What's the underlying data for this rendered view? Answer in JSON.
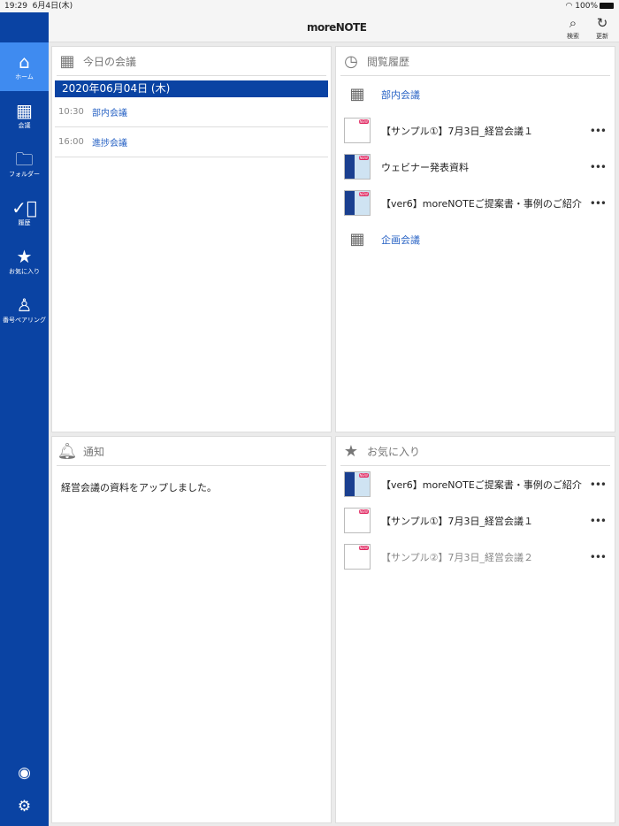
{
  "status": {
    "time": "19:29",
    "date": "6月4日(木)",
    "battery": "100%"
  },
  "header": {
    "logo": "moreNOTE",
    "search": "検索",
    "refresh": "更新"
  },
  "sidebar": {
    "items": [
      {
        "label": "ホーム",
        "icon": "home-icon"
      },
      {
        "label": "会議",
        "icon": "calendar-icon"
      },
      {
        "label": "フォルダー",
        "icon": "folder-icon"
      },
      {
        "label": "履歴",
        "icon": "history-icon"
      },
      {
        "label": "お気に入り",
        "icon": "star-icon"
      },
      {
        "label": "番号ペアリング",
        "icon": "pairing-icon"
      }
    ]
  },
  "today": {
    "title": "今日の会議",
    "date": "2020年06月04日 (木)",
    "meetings": [
      {
        "time": "10:30",
        "name": "部内会議"
      },
      {
        "time": "16:00",
        "name": "進捗会議"
      }
    ]
  },
  "history": {
    "title": "閲覧履歴",
    "items": [
      {
        "name": "部内会議"
      },
      {
        "name": "【サンプル①】7月3日_経営会議１"
      },
      {
        "name": "ウェビナー発表資料"
      },
      {
        "name": "【ver6】moreNOTEご提案書・事例のご紹介"
      },
      {
        "name": "企画会議"
      }
    ]
  },
  "notice": {
    "title": "通知",
    "message": "経営会議の資料をアップしました。"
  },
  "favorites": {
    "title": "お気に入り",
    "items": [
      {
        "name": "【ver6】moreNOTEご提案書・事例のご紹介"
      },
      {
        "name": "【サンプル①】7月3日_経営会議１"
      },
      {
        "name": "【サンプル②】7月3日_経営会議２"
      }
    ]
  },
  "badge": "NEW",
  "more": "•••"
}
